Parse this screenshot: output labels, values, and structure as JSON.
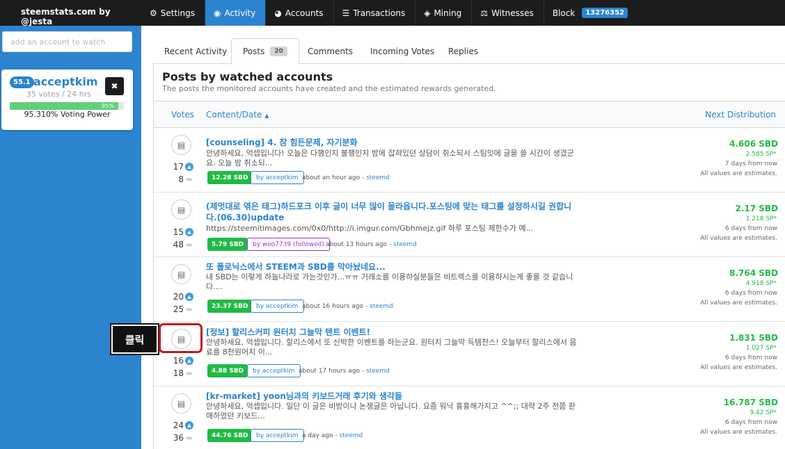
{
  "brand": "steemstats.com by @jesta",
  "sidebar": {
    "watch_placeholder": "add an account to watch",
    "account": {
      "reputation": "55.1",
      "name": "acceptkim",
      "votes": "35 votes / 24 hrs",
      "close_icon": "✖",
      "voting_power_bar": "95%",
      "voting_power_fraction": 0.95,
      "voting_power_text": "95.310% Voting Power"
    }
  },
  "nav": {
    "settings": "Settings",
    "activity": "Activity",
    "accounts": "Accounts",
    "transactions": "Transactions",
    "mining": "Mining",
    "witnesses": "Witnesses",
    "block": "Block",
    "block_number": "13276352"
  },
  "tabs": {
    "recent": "Recent Activity",
    "posts": "Posts",
    "posts_count": "20",
    "comments": "Comments",
    "incoming": "Incoming Votes",
    "replies": "Replies"
  },
  "panel": {
    "title": "Posts by watched accounts",
    "subtitle": "The posts the monitored accounts have created and the estimated rewards generated.",
    "col_votes": "Votes",
    "col_content": "Content/Date",
    "col_dist": "Next Distribution"
  },
  "rows": [
    {
      "votes": "17",
      "comments": "8",
      "title": "[counseling] 4. 참 힘든문제, 자기분화",
      "body": "안녕하세요, 억셉입니다! 오늘은 다행인지 불행인지 밤에 잡혀있던 상담이 취소되서 스팀잇에 글을 쓸 시간이 생겼군요. 오늘 밤 취소되...",
      "reward": "12.28 SBD",
      "author": "by acceptkim",
      "time": "about an hour ago - ",
      "app": "steemd",
      "sbd": "4.606 SBD",
      "sp": "2.585 SP*",
      "when": "7 days from now",
      "note": "All values are estimates."
    },
    {
      "votes": "15",
      "comments": "48",
      "title": "(제멋대로 엮은 태그)하드포크 이후 글이 너무 많이 올라옵니다.포스팅에 맞는 태그를 설정하시길 권합니다.(06.30)update",
      "body": "https://steemitimages.com/0x0/http://i.imgur.com/Gbhmejz.gif 하루 포스팅 제한수가 예...",
      "reward": "5.79 SBD",
      "author": "by woo7739 (followed)",
      "time": "about 13 hours ago - ",
      "app": "steemd",
      "sbd": "2.17 SBD",
      "sp": "1.218 SP*",
      "when": "6 days from now",
      "note": "All values are estimates."
    },
    {
      "votes": "20",
      "comments": "25",
      "title": "또 폴로닉스에서 STEEM과 SBD를 막아놨네요...",
      "body": "내 SBD는 이렇게 하늘나라로 가는것인가...ㅠㅠ 거래소를 이용하실분들은 비트렉스를 이용하시는게 좋을 것 같습니다....",
      "reward": "23.37 SBD",
      "author": "by acceptkim",
      "time": "about 16 hours ago - ",
      "app": "steemd",
      "sbd": "8.764 SBD",
      "sp": "4.918 SP*",
      "when": "6 days from now",
      "note": "All values are estimates."
    },
    {
      "votes": "16",
      "comments": "18",
      "title": "[정보] 할리스커피 원터치 그늘막 텐트 이벤트!",
      "body": "안녕하세요, 억셉입니다. 할리스에서 또 신박한 이벤트를 하는군요. 원터치 그늘막 득템찬스! 오늘부터 할리스에서 음료를 8천원어치 이...",
      "reward": "4.88 SBD",
      "author": "by acceptkim",
      "time": "about 17 hours ago - ",
      "app": "steemd",
      "sbd": "1.831 SBD",
      "sp": "1.027 SP*",
      "when": "6 days from now",
      "note": "All values are estimates."
    },
    {
      "votes": "24",
      "comments": "36",
      "title": "[kr-market] yoon님과의 키보드거래 후기와 생각들",
      "body": "안녕하세요, 억셉입니다. 일단 이 글은 비방이나 논쟁글은 아닙니다. 요즘 워낙 흉흉해가지고 ^^;; 대략 2주 전쯤 판매하였던 키보드...",
      "reward": "44.76 SBD",
      "author": "by acceptkim",
      "time": "a day ago - ",
      "app": "steemd",
      "sbd": "16.787 SBD",
      "sp": "9.42 SP*",
      "when": "6 days from now",
      "note": "All values are estimates."
    }
  ],
  "annotation": "클릭"
}
